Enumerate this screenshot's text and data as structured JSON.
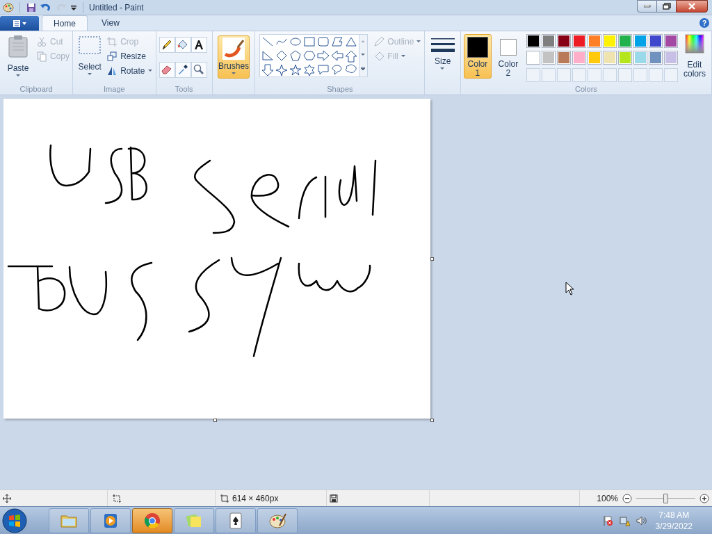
{
  "window": {
    "title": "Untitled - Paint"
  },
  "help": "?",
  "tabs": [
    {
      "label": "Home",
      "selected": true
    },
    {
      "label": "View",
      "selected": false
    }
  ],
  "clipboard": {
    "paste": "Paste",
    "cut": {
      "label": "Cut",
      "disabled": true
    },
    "copy": {
      "label": "Copy",
      "disabled": true
    },
    "group": "Clipboard"
  },
  "image": {
    "select": "Select",
    "crop": {
      "label": "Crop",
      "disabled": true
    },
    "resize": {
      "label": "Resize",
      "disabled": false
    },
    "rotate": {
      "label": "Rotate",
      "disabled": false
    },
    "group": "Image"
  },
  "tools": {
    "group": "Tools"
  },
  "brushes": {
    "label": "Brushes",
    "selected": true
  },
  "shapes": {
    "outline": {
      "label": "Outline",
      "disabled": true
    },
    "fill": {
      "label": "Fill",
      "disabled": true
    },
    "group": "Shapes"
  },
  "size": {
    "label": "Size"
  },
  "colors": {
    "color1": {
      "label": "Color",
      "number": "1",
      "selected": true,
      "color": "#000000"
    },
    "color2": {
      "label": "Color",
      "number": "2",
      "selected": false,
      "color": "#ffffff"
    },
    "palette": [
      {
        "color": "#000000"
      },
      {
        "color": "#7f7f7f"
      },
      {
        "color": "#880015"
      },
      {
        "color": "#ed1c24"
      },
      {
        "color": "#ff7f27"
      },
      {
        "color": "#fff200"
      },
      {
        "color": "#22b14c"
      },
      {
        "color": "#00a2e8"
      },
      {
        "color": "#3f48cc"
      },
      {
        "color": "#a349a4"
      },
      {
        "color": "#ffffff"
      },
      {
        "color": "#c3c3c3"
      },
      {
        "color": "#b97a57"
      },
      {
        "color": "#ffaec9"
      },
      {
        "color": "#ffc90e"
      },
      {
        "color": "#efe4b0"
      },
      {
        "color": "#b5e61d"
      },
      {
        "color": "#99d9ea"
      },
      {
        "color": "#7092be"
      },
      {
        "color": "#c8bfe7"
      }
    ],
    "edit": [
      "Edit",
      "colors"
    ],
    "group": "Colors"
  },
  "status_bar": {
    "dimensions": "614 × 460px",
    "zoom": "100%",
    "zoom_level": {
      "level": 0.5
    }
  },
  "taskbar": {
    "apps": [
      {
        "kind": "folder",
        "selected": false
      },
      {
        "kind": "media",
        "selected": false
      },
      {
        "kind": "browser",
        "selected": true
      },
      {
        "kind": "notes",
        "selected": false
      },
      {
        "kind": "cards",
        "selected": false
      },
      {
        "kind": "paint",
        "selected": false
      }
    ],
    "time": "7:48 AM",
    "date": "3/29/2022"
  }
}
